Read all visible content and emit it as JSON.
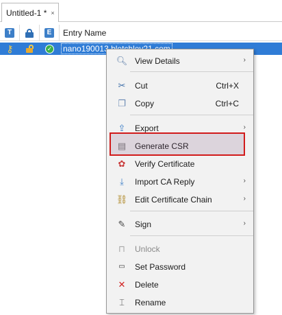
{
  "tab": {
    "title": "Untitled-1 *",
    "close_icon": "×"
  },
  "table": {
    "headers": {
      "type": "T",
      "lock": "lock-icon",
      "expiry": "E",
      "entry_name": "Entry Name"
    },
    "rows": [
      {
        "entry_name": "nano190013.bletchley21.com"
      }
    ]
  },
  "context_menu": {
    "items": [
      {
        "label": "View Details",
        "icon": "magnifier-icon",
        "submenu": true
      },
      {
        "label": "Cut",
        "shortcut": "Ctrl+X",
        "icon": "scissors-icon"
      },
      {
        "label": "Copy",
        "shortcut": "Ctrl+C",
        "icon": "copy-icon"
      },
      {
        "label": "Export",
        "icon": "export-icon",
        "submenu": true
      },
      {
        "label": "Generate CSR",
        "icon": "document-icon"
      },
      {
        "label": "Verify Certificate",
        "icon": "certificate-ribbon-icon"
      },
      {
        "label": "Import CA Reply",
        "icon": "import-icon",
        "submenu": true
      },
      {
        "label": "Edit Certificate Chain",
        "icon": "chain-icon",
        "submenu": true
      },
      {
        "label": "Sign",
        "icon": "pen-icon",
        "submenu": true
      },
      {
        "label": "Unlock",
        "icon": "unlock-icon",
        "disabled": true
      },
      {
        "label": "Set Password",
        "icon": "password-icon"
      },
      {
        "label": "Delete",
        "icon": "delete-x-icon"
      },
      {
        "label": "Rename",
        "icon": "rename-icon"
      }
    ],
    "arrow": "›"
  },
  "colors": {
    "selection": "#2f7cd6",
    "highlight_border": "#d11a1a",
    "menu_bg": "#f2f2f2"
  }
}
